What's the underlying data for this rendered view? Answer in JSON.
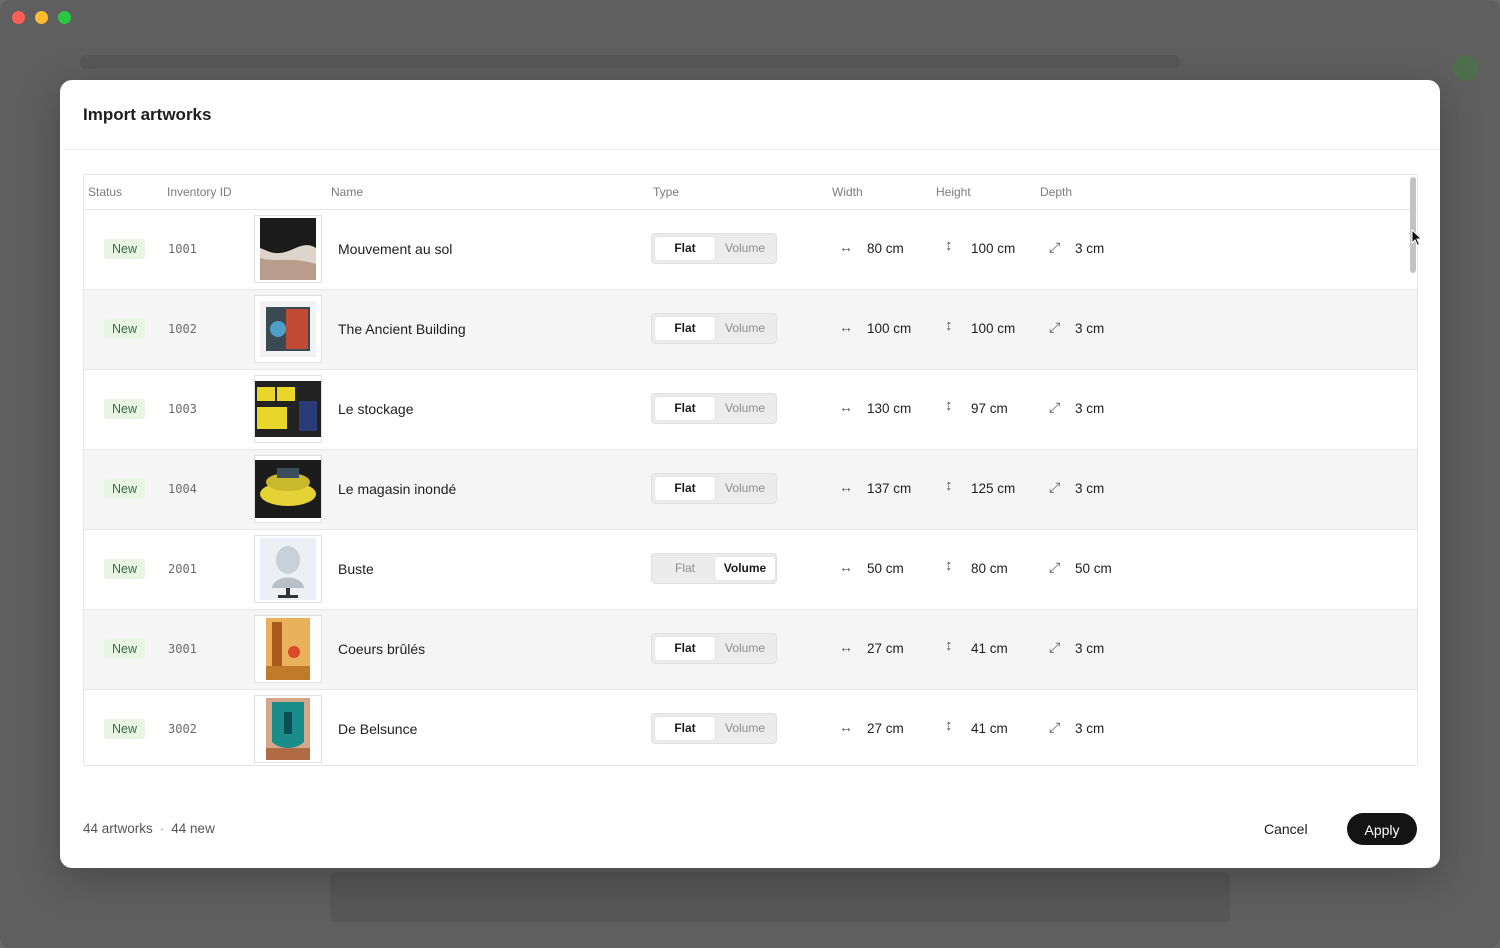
{
  "dialog": {
    "title": "Import artworks"
  },
  "columns": {
    "status": "Status",
    "inventory_id": "Inventory ID",
    "name": "Name",
    "type": "Type",
    "width": "Width",
    "height": "Height",
    "depth": "Depth"
  },
  "type_options": {
    "flat": "Flat",
    "volume": "Volume"
  },
  "rows": [
    {
      "status": "New",
      "id": "1001",
      "name": "Mouvement au sol",
      "type": "Flat",
      "width": "80 cm",
      "height": "100 cm",
      "depth": "3 cm"
    },
    {
      "status": "New",
      "id": "1002",
      "name": "The Ancient Building",
      "type": "Flat",
      "width": "100 cm",
      "height": "100 cm",
      "depth": "3 cm"
    },
    {
      "status": "New",
      "id": "1003",
      "name": "Le stockage",
      "type": "Flat",
      "width": "130 cm",
      "height": "97 cm",
      "depth": "3 cm"
    },
    {
      "status": "New",
      "id": "1004",
      "name": "Le magasin inondé",
      "type": "Flat",
      "width": "137 cm",
      "height": "125 cm",
      "depth": "3 cm"
    },
    {
      "status": "New",
      "id": "2001",
      "name": "Buste",
      "type": "Volume",
      "width": "50 cm",
      "height": "80 cm",
      "depth": "50 cm"
    },
    {
      "status": "New",
      "id": "3001",
      "name": "Coeurs brûlés",
      "type": "Flat",
      "width": "27 cm",
      "height": "41 cm",
      "depth": "3 cm"
    },
    {
      "status": "New",
      "id": "3002",
      "name": "De Belsunce",
      "type": "Flat",
      "width": "27 cm",
      "height": "41 cm",
      "depth": "3 cm"
    }
  ],
  "footer": {
    "total": "44 artworks",
    "separator": "·",
    "new_count": "44 new",
    "cancel_label": "Cancel",
    "apply_label": "Apply"
  },
  "icons": {
    "width": "horizontal-arrow-icon",
    "height": "vertical-arrow-icon",
    "depth": "diagonal-arrow-icon"
  },
  "colors": {
    "badge_bg": "#e9f5e4",
    "badge_text": "#3a6b3e",
    "apply_bg": "#141414"
  }
}
